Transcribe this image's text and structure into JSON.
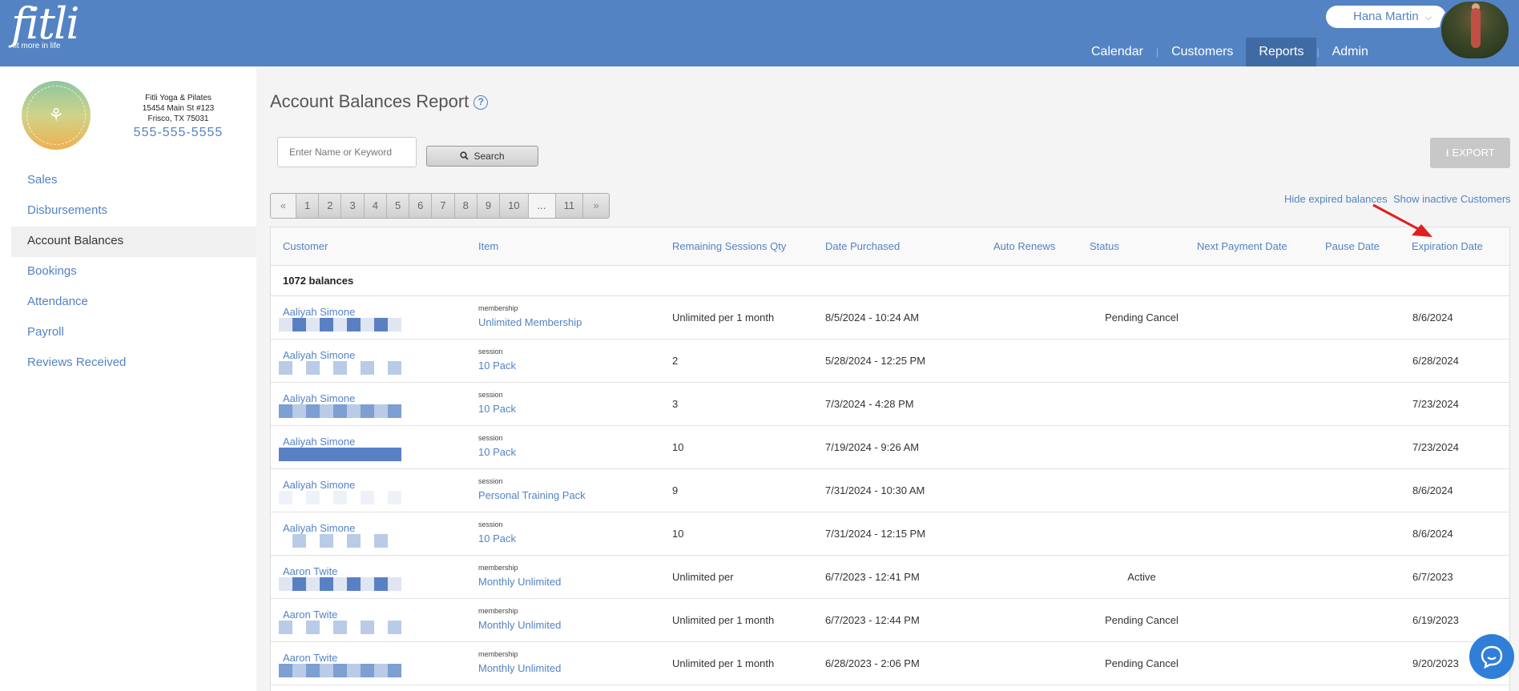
{
  "header": {
    "logo_word": "fitli",
    "logo_tagline": "fit more in life",
    "user_name": "Hana Martin",
    "nav": [
      "Calendar",
      "Customers",
      "Reports",
      "Admin"
    ],
    "active_nav": "Reports"
  },
  "studio": {
    "name": "Fitli Yoga & Pilates",
    "address1": "15454 Main St #123",
    "address2": "Frisco, TX 75031",
    "phone": "555-555-5555"
  },
  "sidebar": {
    "items": [
      "Sales",
      "Disbursements",
      "Account Balances",
      "Bookings",
      "Attendance",
      "Payroll",
      "Reviews Received"
    ],
    "active": "Account Balances"
  },
  "page": {
    "title": "Account Balances Report",
    "search_placeholder": "Enter Name or Keyword",
    "search_label": "Search",
    "export_label": "EXPORT",
    "hide_expired": "Hide expired balances",
    "show_inactive": "Show inactive Customers"
  },
  "pager": {
    "prev": "«",
    "pages": [
      "1",
      "2",
      "3",
      "4",
      "5",
      "6",
      "7",
      "8",
      "9",
      "10"
    ],
    "dots": "...",
    "last": "11",
    "next": "»"
  },
  "table": {
    "columns": [
      "Customer",
      "Item",
      "Remaining Sessions Qty",
      "Date Purchased",
      "Auto Renews",
      "Status",
      "Next Payment Date",
      "Pause Date",
      "Expiration Date"
    ],
    "count_label": "1072 balances",
    "rows": [
      {
        "customer": "Aaliyah Simone",
        "item_type": "membership",
        "item": "Unlimited Membership",
        "remaining": "Unlimited per 1 month",
        "purchased": "8/5/2024 - 10:24 AM",
        "status": "Pending Cancel",
        "expiration": "8/6/2024"
      },
      {
        "customer": "Aaliyah Simone",
        "item_type": "session",
        "item": "10 Pack",
        "remaining": "2",
        "purchased": "5/28/2024 - 12:25 PM",
        "status": "",
        "expiration": "6/28/2024"
      },
      {
        "customer": "Aaliyah Simone",
        "item_type": "session",
        "item": "10 Pack",
        "remaining": "3",
        "purchased": "7/3/2024 - 4:28 PM",
        "status": "",
        "expiration": "7/23/2024"
      },
      {
        "customer": "Aaliyah Simone",
        "item_type": "session",
        "item": "10 Pack",
        "remaining": "10",
        "purchased": "7/19/2024 - 9:26 AM",
        "status": "",
        "expiration": "7/23/2024"
      },
      {
        "customer": "Aaliyah Simone",
        "item_type": "session",
        "item": "Personal Training Pack",
        "remaining": "9",
        "purchased": "7/31/2024 - 10:30 AM",
        "status": "",
        "expiration": "8/6/2024"
      },
      {
        "customer": "Aaliyah Simone",
        "item_type": "session",
        "item": "10 Pack",
        "remaining": "10",
        "purchased": "7/31/2024 - 12:15 PM",
        "status": "",
        "expiration": "8/6/2024"
      },
      {
        "customer": "Aaron Twite",
        "item_type": "membership",
        "item": "Monthly Unlimited",
        "remaining": "Unlimited per",
        "purchased": "6/7/2023 - 12:41 PM",
        "status": "Active",
        "expiration": "6/7/2023"
      },
      {
        "customer": "Aaron Twite",
        "item_type": "membership",
        "item": "Monthly Unlimited",
        "remaining": "Unlimited per 1 month",
        "purchased": "6/7/2023 - 12:44 PM",
        "status": "Pending Cancel",
        "expiration": "6/19/2023"
      },
      {
        "customer": "Aaron Twite",
        "item_type": "membership",
        "item": "Monthly Unlimited",
        "remaining": "Unlimited per 1 month",
        "purchased": "6/28/2023 - 2:06 PM",
        "status": "Pending Cancel",
        "expiration": "9/20/2023"
      }
    ]
  },
  "colors": {
    "header_bg": "#5383c3",
    "link": "#5383c3",
    "active_nav": "#3f6aa4",
    "annotation_arrow": "#e02020",
    "chat": "#2f7fd8"
  },
  "icons": [
    "help-icon",
    "search-icon",
    "download-icon",
    "chevron-down-icon",
    "chat-icon",
    "annotation-arrow"
  ]
}
